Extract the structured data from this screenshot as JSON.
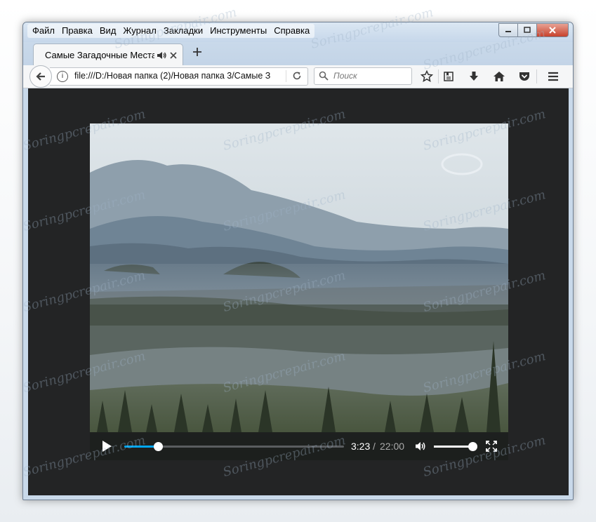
{
  "menu": {
    "items": [
      "Файл",
      "Правка",
      "Вид",
      "Журнал",
      "Закладки",
      "Инструменты",
      "Справка"
    ]
  },
  "tab": {
    "title": "Самые Загадочные Места.w"
  },
  "navbar": {
    "url": "file:///D:/Новая папка (2)/Новая папка 3/Самые З",
    "search_placeholder": "Поиск"
  },
  "player": {
    "current_time": "3:23",
    "separator": "/",
    "duration": "22:00",
    "progress": 0.154,
    "volume": 1.0
  },
  "watermark": {
    "text": "Soringpcrepair.com"
  },
  "colors": {
    "progress_fill": "#00a7f5",
    "content_bg": "#232425",
    "close_button": "#c7412c"
  }
}
